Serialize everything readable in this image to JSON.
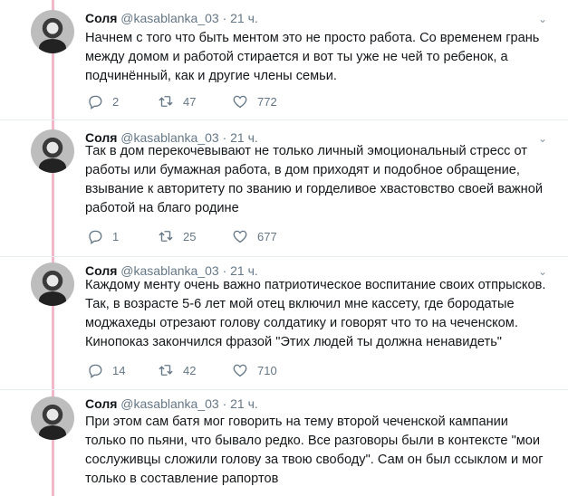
{
  "tweets": [
    {
      "name": "Соля",
      "handle": "@kasablanka_03",
      "sep": "·",
      "time": "21 ч.",
      "text": "Начнем с того что быть ментом это не просто работа. Со временем грань между домом и работой стирается и вот ты уже не чей то ребенок, а подчинённый, как и другие члены семьи.",
      "replies": "2",
      "retweets": "47",
      "likes": "772"
    },
    {
      "name": "Соля",
      "handle": "@kasablanka_03",
      "sep": "·",
      "time": "21 ч.",
      "text": "Так в дом перекочевывают не только личный эмоциональный стресс от работы или бумажная работа, в дом приходят и подобное обращение, взывание к авторитету по званию и горделивое хвастовство своей важной работой на благо родине",
      "replies": "1",
      "retweets": "25",
      "likes": "677"
    },
    {
      "name": "Соля",
      "handle": "@kasablanka_03",
      "sep": "·",
      "time": "21 ч.",
      "text": "Каждому менту очень важно патриотическое воспитание своих отпрысков. Так, в возрасте 5-6 лет мой отец включил мне кассету, где бородатые моджахеды отрезают голову солдатику и говорят что то на чеченском. Кинопоказ закончился фразой \"Этих людей ты должна ненавидеть\"",
      "replies": "14",
      "retweets": "42",
      "likes": "710"
    },
    {
      "name": "Соля",
      "handle": "@kasablanka_03",
      "sep": "·",
      "time": "21 ч.",
      "text": "При этом сам батя мог говорить на тему второй чеченской кампании только по пьяни, что бывало редко. Все разговоры были в контексте \"мои сослуживцы сложили голову за твою свободу\". Сам он был ссыкلом и мог только в составление рапортов"
    }
  ],
  "icons": {
    "more": "chevron-down-icon",
    "reply": "reply-icon",
    "retweet": "retweet-icon",
    "like": "heart-icon"
  },
  "colors": {
    "thread_line": "#f0b8c8",
    "text": "#14171a",
    "secondary": "#657786",
    "divider": "#e6ecf0"
  }
}
